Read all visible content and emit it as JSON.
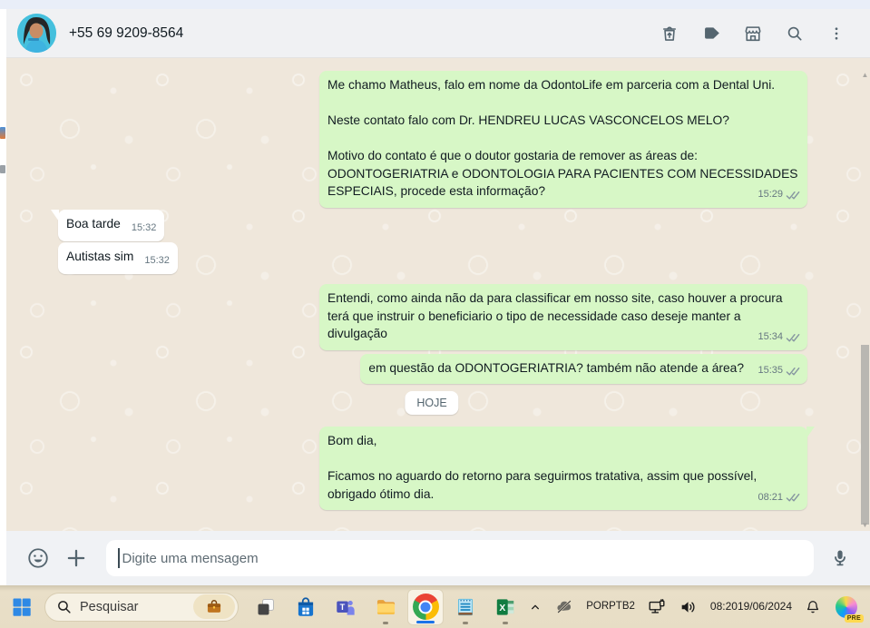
{
  "header": {
    "phone": "+55 69 9209-8564"
  },
  "chat": {
    "date_separator": "HOJE",
    "messages": [
      {
        "direction": "out",
        "text": "Me chamo Matheus, falo em nome da OdontoLife em parceria com a Dental Uni.\n\nNeste contato falo com Dr. HENDREU LUCAS VASCONCELOS MELO?\n\nMotivo do contato é que o doutor gostaria de remover as áreas de: ODONTOGERIATRIA e ODONTOLOGIA PARA PACIENTES COM NECESSIDADES ESPECIAIS, procede esta informação?",
        "time": "15:29",
        "status": "delivered"
      },
      {
        "direction": "in",
        "text": "Boa tarde",
        "time": "15:32"
      },
      {
        "direction": "in",
        "text": "Autistas sim",
        "time": "15:32"
      },
      {
        "direction": "out",
        "text": "Entendi, como ainda não da para classificar em nosso site, caso houver a procura terá que instruir o beneficiario o tipo de necessidade caso deseje manter a divulgação",
        "time": "15:34",
        "status": "delivered"
      },
      {
        "direction": "out",
        "text": "em questão da ODONTOGERIATRIA? também não atende a área?",
        "time": "15:35",
        "status": "delivered"
      },
      {
        "direction": "out",
        "text": "Bom dia,\n\nFicamos no aguardo do retorno para seguirmos tratativa, assim que possível, obrigado ótimo dia.",
        "time": "08:21",
        "status": "delivered"
      }
    ]
  },
  "composer": {
    "placeholder": "Digite uma mensagem"
  },
  "taskbar": {
    "search_placeholder": "Pesquisar",
    "language": {
      "line1": "POR",
      "line2": "PTB2"
    },
    "clock": {
      "time": "08:20",
      "date": "19/06/2024"
    },
    "copilot_badge": "PRE"
  },
  "icons": {
    "header": [
      "delete-icon",
      "label-icon",
      "storefront-icon",
      "search-icon",
      "kebab-menu-icon"
    ],
    "composer": [
      "emoji-icon",
      "plus-icon",
      "mic-icon"
    ],
    "taskbar": [
      "start-icon",
      "search-icon",
      "briefcase-icon",
      "task-view-icon",
      "store-icon",
      "teams-icon",
      "file-explorer-icon",
      "chrome-icon",
      "notepad-icon",
      "excel-icon"
    ],
    "tray": [
      "chevron-up-icon",
      "onedrive-paused-icon",
      "network-icon",
      "volume-icon",
      "bell-icon",
      "copilot-icon"
    ]
  },
  "colors": {
    "outgoing_bubble": "#d7f7c6",
    "chat_background": "#efe7db",
    "taskbar_background": "#e7ddc5",
    "chrome_active_underline": "#1a73e8",
    "check_gray": "#8696a0"
  }
}
